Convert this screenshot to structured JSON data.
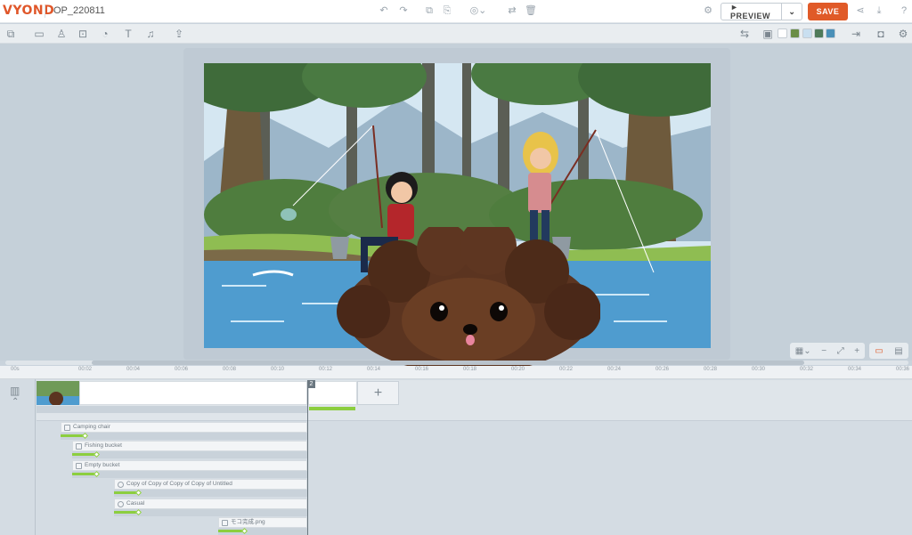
{
  "app": {
    "logo": "VYOND",
    "project_title": "OP_220811"
  },
  "top_actions": {
    "preview_label": "► PREVIEW",
    "preview_caret": "⌄",
    "save_label": "SAVE"
  },
  "colors": {
    "accent": "#e05a28",
    "progress": "#8cce3f"
  },
  "toolbar_icons": [
    "import-icon",
    "scene-icon",
    "character-icon",
    "prop-icon",
    "chart-icon",
    "text-icon",
    "audio-icon",
    "upload-icon"
  ],
  "swatches": [
    "#ffffff",
    "#6b8e47",
    "#c9dff0",
    "#4f7a5a",
    "#4a90b8"
  ],
  "timeline": {
    "scene_number": "2",
    "add_scene_label": "+",
    "ruler_labels": [
      "00s",
      "00:02",
      "00:04",
      "00:06",
      "00:08",
      "00:10",
      "00:12",
      "00:14",
      "00:16",
      "00:18",
      "00:20",
      "00:22",
      "00:24",
      "00:26",
      "00:28",
      "00:30",
      "00:32",
      "00:34",
      "00:36"
    ],
    "layers": [
      {
        "label": "Camping chair",
        "icon": "prop-icon"
      },
      {
        "label": "Fishing bucket",
        "icon": "prop-icon"
      },
      {
        "label": "Empty bucket",
        "icon": "prop-icon"
      },
      {
        "label": "Copy of Copy of Copy of Copy of Untitled",
        "icon": "character-icon"
      },
      {
        "label": "Casual",
        "icon": "character-icon"
      },
      {
        "label": "モコ完成.png",
        "icon": "image-icon"
      }
    ]
  }
}
